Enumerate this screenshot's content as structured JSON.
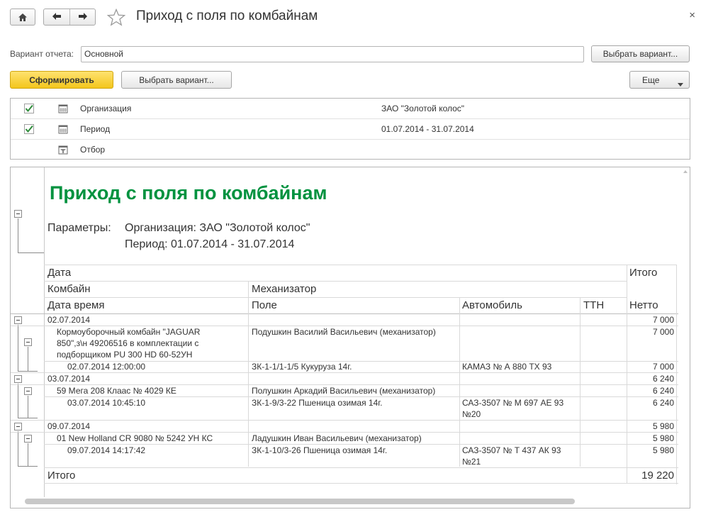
{
  "window": {
    "title": "Приход с поля по комбайнам",
    "close": "×"
  },
  "variant": {
    "label": "Вариант отчета:",
    "value": "Основной",
    "select_button": "Выбрать вариант..."
  },
  "toolbar": {
    "generate": "Сформировать",
    "select_variant": "Выбрать вариант...",
    "more": "Еще"
  },
  "settings": [
    {
      "name": "Организация",
      "value": "ЗАО \"Золотой колос\"",
      "checked": true
    },
    {
      "name": "Период",
      "value": "01.07.2014 - 31.07.2014",
      "checked": true
    },
    {
      "name": "Отбор",
      "value": "",
      "checked": false
    }
  ],
  "report": {
    "title": "Приход с поля по комбайнам",
    "params_label": "Параметры:",
    "params": [
      "Организация: ЗАО \"Золотой колос\"",
      "Период: 01.07.2014 - 31.07.2014"
    ],
    "headers": {
      "date": "Дата",
      "total": "Итого",
      "combine": "Комбайн",
      "operator": "Механизатор",
      "datetime": "Дата время",
      "field": "Поле",
      "vehicle": "Автомобиль",
      "ttn": "ТТН",
      "net": "Нетто"
    },
    "groups": [
      {
        "date": "02.07.2014",
        "total": "7 000",
        "combine": "Кормоуборочный комбайн \"JAGUAR 850\",з\\н 49206516 в комплектации с подборщиком PU 300 HD 60-52УН",
        "combine_lines": [
          "Кормоуборочный комбайн \"JAGUAR",
          "850\",з\\н 49206516 в комплектации с",
          "подборщиком PU 300 HD 60-52УН"
        ],
        "operator": "Подушкин Василий Васильевич (механизатор)",
        "combine_total": "7 000",
        "detail": {
          "datetime": "02.07.2014 12:00:00",
          "field": "ЗК-1-1/1-1/5 Кукуруза 14г.",
          "vehicle_lines": [
            "КАМАЗ  № А 880 ТХ 93"
          ],
          "net": "7 000"
        }
      },
      {
        "date": "03.07.2014",
        "total": "6 240",
        "combine_lines": [
          "59 Мега 208 Клаас № 4029 КЕ"
        ],
        "operator": "Полушкин Аркадий Васильевич (механизатор)",
        "combine_total": "6 240",
        "detail": {
          "datetime": "03.07.2014 10:45:10",
          "field": "ЗК-1-9/3-22 Пшеница озимая 14г.",
          "vehicle_lines": [
            "САЗ-3507 № М 697 АЕ 93",
            "№20"
          ],
          "net": "6 240"
        }
      },
      {
        "date": "09.07.2014",
        "total": "5 980",
        "combine_lines": [
          "01 New Holland CR 9080 № 5242 УН КС"
        ],
        "operator": "Ладушкин Иван Васильевич (механизатор)",
        "combine_total": "5 980",
        "detail": {
          "datetime": "09.07.2014 14:17:42",
          "field": "ЗК-1-10/3-26 Пшеница озимая 14г.",
          "vehicle_lines": [
            "САЗ-3507 № Т 437 АК 93",
            "№21"
          ],
          "net": "5 980"
        }
      }
    ],
    "grand_total_label": "Итого",
    "grand_total": "19 220"
  },
  "colors": {
    "title_green": "#00923f",
    "primary_button": "#f3c61c",
    "check_green": "#2e8b3a"
  }
}
